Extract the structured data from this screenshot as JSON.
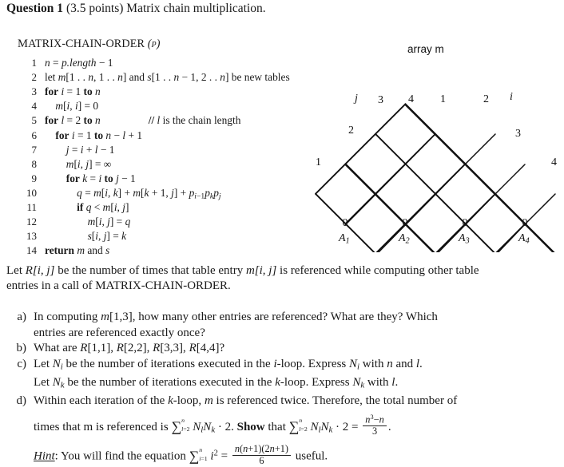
{
  "title": {
    "question_label": "Question 1",
    "points": "(3.5 points)",
    "topic": "Matrix chain multiplication."
  },
  "pseudocode": {
    "procedure_name": "Matrix-Chain-Order",
    "procedure_arg": "(p)",
    "lines": [
      {
        "num": "1",
        "code": "n = p.length − 1",
        "comment": ""
      },
      {
        "num": "2",
        "code": "let m[1..n, 1..n] and s[1..n − 1, 2..n] be new tables",
        "comment": ""
      },
      {
        "num": "3",
        "code": "for i = 1 to n",
        "comment": ""
      },
      {
        "num": "4",
        "code": "m[i, i] = 0",
        "comment": ""
      },
      {
        "num": "5",
        "code": "for l = 2 to n",
        "comment": "// l is the chain length"
      },
      {
        "num": "6",
        "code": "for i = 1 to n − l + 1",
        "comment": ""
      },
      {
        "num": "7",
        "code": "j = i + l − 1",
        "comment": ""
      },
      {
        "num": "8",
        "code": "m[i, j] = ∞",
        "comment": ""
      },
      {
        "num": "9",
        "code": "for k = i to j − 1",
        "comment": ""
      },
      {
        "num": "10",
        "code": "q = m[i, k] + m[k + 1, j] + p(i−1) p(k) p(j)",
        "comment": ""
      },
      {
        "num": "11",
        "code": "if q < m[i, j]",
        "comment": ""
      },
      {
        "num": "12",
        "code": "m[i, j] = q",
        "comment": ""
      },
      {
        "num": "13",
        "code": "s[i, j] = k",
        "comment": ""
      },
      {
        "num": "14",
        "code": "return m and s",
        "comment": ""
      }
    ]
  },
  "diagram": {
    "caption": "array m",
    "axis_label_j": "j",
    "axis_label_i": "i",
    "left_ticks": [
      "4",
      "3",
      "2",
      "1"
    ],
    "right_ticks": [
      "1",
      "2",
      "3",
      "4"
    ],
    "bottom_labels": [
      "A",
      "A",
      "A",
      "A"
    ],
    "bottom_subscripts": [
      "1",
      "2",
      "3",
      "4"
    ],
    "base_cell_values": [
      "0",
      "0",
      "0",
      "0"
    ],
    "rows": 4
  },
  "body": {
    "intro_line1_a": "Let ",
    "intro_R": "R[i, j]",
    "intro_line1_b": " be the number of times that table entry ",
    "intro_m": "m[i, j]",
    "intro_line1_c": " is referenced while computing other table",
    "intro_line2": "entries in a call of MATRIX-CHAIN-ORDER.",
    "items": [
      {
        "mark": "a)",
        "line1": "In computing m[1,3], how many other entries are referenced? What are they? Which",
        "line2": "entries are referenced exactly once?"
      },
      {
        "mark": "b)",
        "line1": "What are R[1,1], R[2,2], R[3,3], R[4,4]?",
        "line2": ""
      },
      {
        "mark": "c)",
        "line1": "Let N_i be the number of iterations executed in the i-loop. Express N_i with n and l.",
        "line2": "Let N_k be the number of iterations executed in the k-loop. Express N_k with l."
      },
      {
        "mark": "d)",
        "line1": "Within each iteration of the k-loop, m is referenced twice. Therefore, the total number of",
        "line2": "times that m is referenced is Σ(l=2..n) N_i N_k · 2. Show that Σ(l=2..n) N_i N_k · 2 = (n³−n)/3.",
        "line3": "Hint: You will find the equation Σ(i=1..n) i² = n(n+1)(2n+1)/6 useful."
      }
    ],
    "hint_label": "Hint",
    "hint_text": ": You will find the equation",
    "hint_tail": "useful."
  }
}
